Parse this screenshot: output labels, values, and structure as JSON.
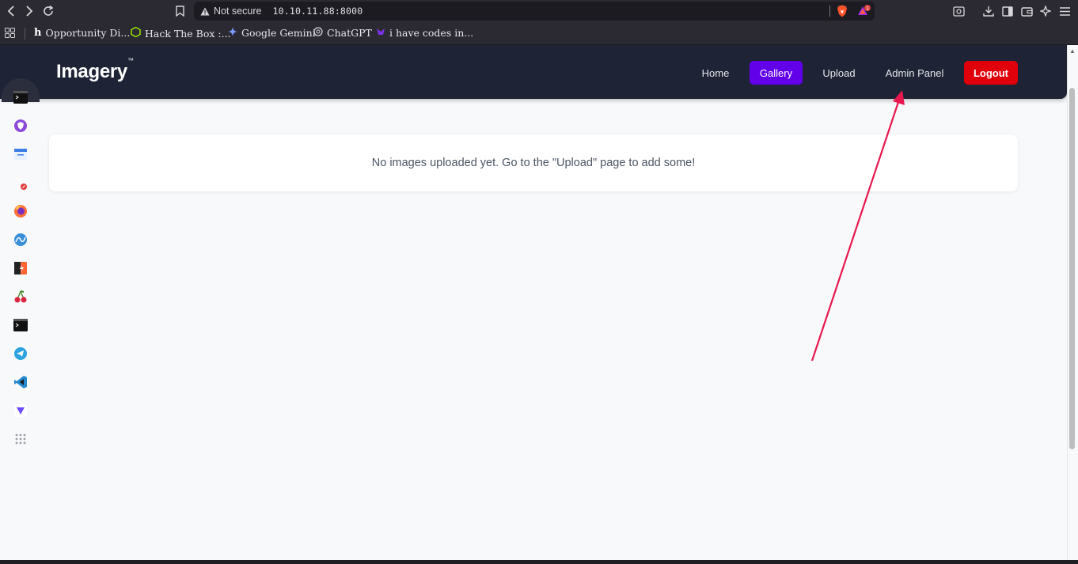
{
  "browser": {
    "security_label": "Not secure",
    "url": "10.10.11.88:8000",
    "rewards_badge": "1"
  },
  "bookmarks": [
    {
      "label": "Opportunity Di..."
    },
    {
      "label": "Hack The Box :..."
    },
    {
      "label": "Google Gemini"
    },
    {
      "label": "ChatGPT"
    },
    {
      "label": "i have codes in..."
    }
  ],
  "site": {
    "logo": "Imagery",
    "logo_tm": "™",
    "nav": {
      "home": "Home",
      "gallery": "Gallery",
      "upload": "Upload",
      "admin_panel": "Admin Panel",
      "logout": "Logout"
    },
    "empty_message": "No images uploaded yet. Go to the \"Upload\" page to add some!"
  },
  "colors": {
    "nav_bg": "#1e2335",
    "gallery_active": "#6200ea",
    "logout": "#e0000b",
    "annotation_arrow": "#e8174f"
  },
  "dock_icons": [
    "terminal-icon",
    "brave-icon",
    "files-icon",
    "text-editor-icon",
    "firefox-icon",
    "wireshark-icon",
    "burpsuite-icon",
    "cherrytree-icon",
    "terminal-icon",
    "telegram-icon",
    "vscode-icon",
    "proton-vpn-icon",
    "app-grid-icon"
  ]
}
